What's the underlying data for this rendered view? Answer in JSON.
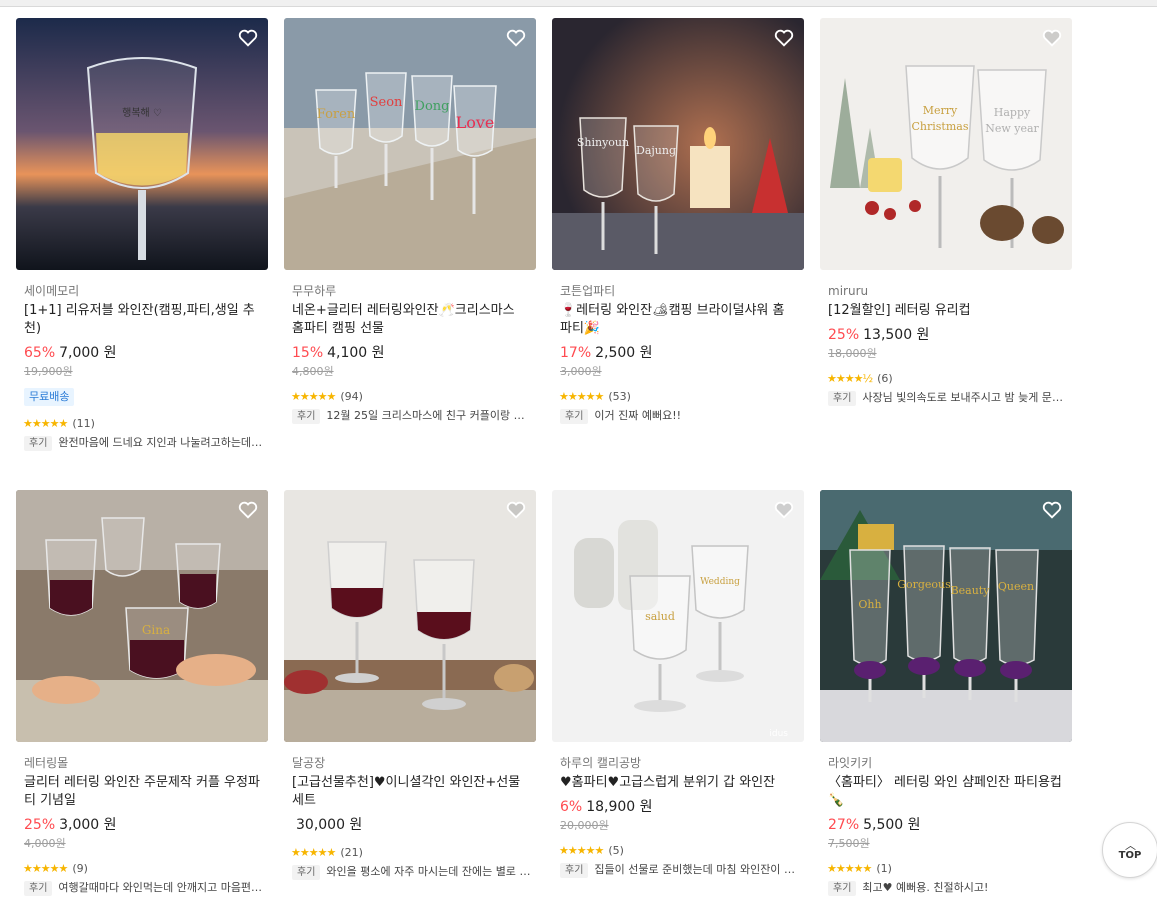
{
  "products": [
    {
      "seller": "세이메모리",
      "title": "[1+1] 리유저블 와인잔(캠핑,파티,생일 추천)",
      "discount": "65%",
      "price": "7,000 원",
      "original_price": "19,900원",
      "badge": "무료배송",
      "stars": "★★★★★",
      "review_count": "(11)",
      "review_tag": "후기",
      "review_text": "완전마음에 드네요 지인과 나눌려고하는데 …",
      "image": "sunset-wine-glass"
    },
    {
      "seller": "무무하루",
      "title": "네온+글리터 레터링와인잔🥂크리스마스 홈파티 캠핑 선물",
      "discount": "15%",
      "price": "4,100 원",
      "original_price": "4,800원",
      "badge": "",
      "stars": "★★★★★",
      "review_count": "(94)",
      "review_tag": "후기",
      "review_text": "12월 25일 크리스마스에 친구 커플이랑 같…",
      "image": "neon-lettering-glasses"
    },
    {
      "seller": "코튼업파티",
      "title": "🍷레터링 와인잔🏕캠핑 브라이덜샤워 홈파티🎉",
      "discount": "17%",
      "price": "2,500 원",
      "original_price": "3,000원",
      "badge": "",
      "stars": "★★★★★",
      "review_count": "(53)",
      "review_tag": "후기",
      "review_text": "이거 진짜 예뻐요!!",
      "image": "candle-lettering-glasses"
    },
    {
      "seller": "miruru",
      "title": "[12월할인] 레터링 유리컵",
      "discount": "25%",
      "price": "13,500 원",
      "original_price": "18,000원",
      "badge": "",
      "stars": "★★★★½",
      "review_count": "(6)",
      "review_tag": "후기",
      "review_text": "사장님 빛의속도로 보내주시고 밤 늦게 문의…",
      "image": "christmas-glasses"
    },
    {
      "seller": "레터링몰",
      "title": "글리터 레터링 와인잔 주문제작 커플 우정파티 기념일",
      "discount": "25%",
      "price": "3,000 원",
      "original_price": "4,000원",
      "badge": "",
      "stars": "★★★★★",
      "review_count": "(9)",
      "review_tag": "후기",
      "review_text": "여행갈때마다 와인먹는데 안깨지고 마음편…",
      "image": "cheers-glasses"
    },
    {
      "seller": "달공장",
      "title": "[고급선물추천]♥이니셜각인 와인잔+선물세트",
      "discount": "",
      "price": "30,000 원",
      "original_price": "",
      "badge": "",
      "stars": "★★★★★",
      "review_count": "(21)",
      "review_tag": "후기",
      "review_text": "와인을 평소에 자주 마시는데 잔에는 별로 관…",
      "image": "red-wine-glasses"
    },
    {
      "seller": "하루의 캘리공방",
      "title": "♥홈파티♥고급스럽게 분위기 갑 와인잔",
      "discount": "6%",
      "price": "18,900 원",
      "original_price": "20,000원",
      "badge": "",
      "stars": "★★★★★",
      "review_count": "(5)",
      "review_tag": "후기",
      "review_text": "집들이 선물로 준비했는데 마침 와인잔이 깨…",
      "image": "white-calligraphy-glasses"
    },
    {
      "seller": "라잇키키",
      "title": "〈홈파티〉 레터링 와인 샴페인잔 파티용컵🍾",
      "discount": "27%",
      "price": "5,500 원",
      "original_price": "7,500원",
      "badge": "",
      "stars": "★★★★★",
      "review_count": "(1)",
      "review_tag": "후기",
      "review_text": "최고♥ 예뻐용. 친절하시고!",
      "image": "champagne-ribbon-glasses"
    }
  ],
  "top_button": {
    "label": "TOP",
    "icon": "chevron-up-icon"
  },
  "icons": {
    "wishlist": "heart-icon"
  },
  "colors": {
    "discount": "#ff4b50",
    "star": "#f7b500",
    "badge_bg": "#e8f4ff",
    "badge_text": "#2a7bd6"
  }
}
